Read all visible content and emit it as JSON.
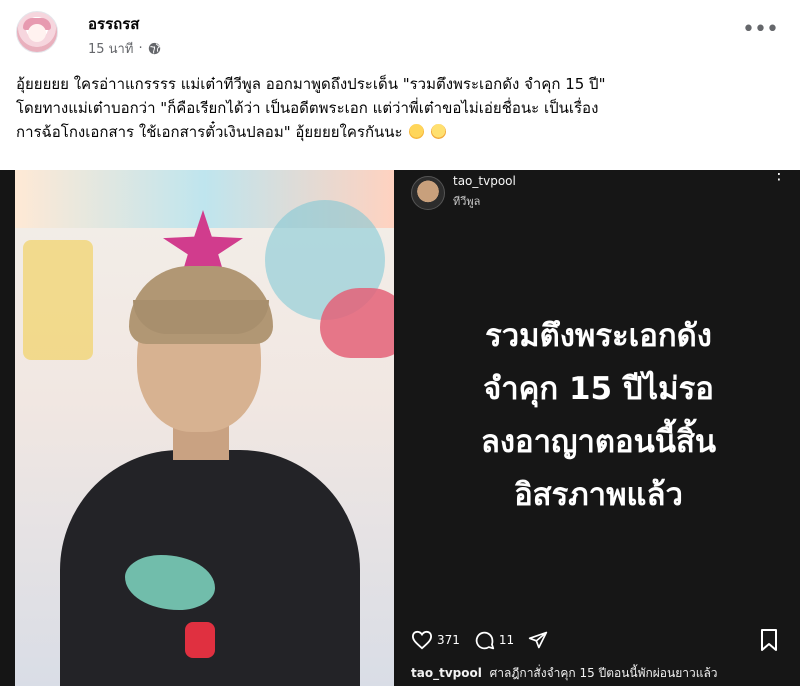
{
  "post": {
    "author": "อรรถรส",
    "time": "15 นาที",
    "separator": "·",
    "privacy_icon": "globe-icon",
    "more_icon": "more-horizontal-icon",
    "more_label": "•••"
  },
  "caption": {
    "line1": "อุ้ยยยยย ใครอ่าาแกรรรร  แม่เต๋าทีวีพูล ออกมาพูดถึงประเด็น \"รวมตึงพระเอกดัง จำคุก 15 ปี\"",
    "line2": "โดยทางแม่เต๋าบอกว่า \"ก็คือเรียกได้ว่า เป็นอดีตพระเอก แต่ว่าพี่เต๋าขอไม่เอ่ยชื่อนะ เป็นเรื่อง",
    "line3": "การฉ้อโกงเอกสาร ใช้เอกสารตั๋วเงินปลอม\"  อุ้ยยยยใครกันนะ",
    "emoji1": "thinking-face-emoji",
    "emoji2": "screaming-face-emoji"
  },
  "instagram": {
    "username": "tao_tvpool",
    "subname": "ทีวีพูล",
    "post_lines": [
      "รวมตึงพระเอกดัง",
      "จำคุก 15 ปีไม่รอ",
      "ลงอาญาตอนนี้สิ้น",
      "อิสรภาพแล้ว"
    ],
    "likes": "371",
    "comments": "11",
    "caption_user": "tao_tvpool",
    "caption_text": "ศาลฎีกาสั่งจำคุก 15 ปีตอนนี้พักผ่อนยาวแล้ว"
  },
  "colors": {
    "text_primary": "#050505",
    "text_secondary": "#65676b",
    "ig_background": "#161616"
  }
}
